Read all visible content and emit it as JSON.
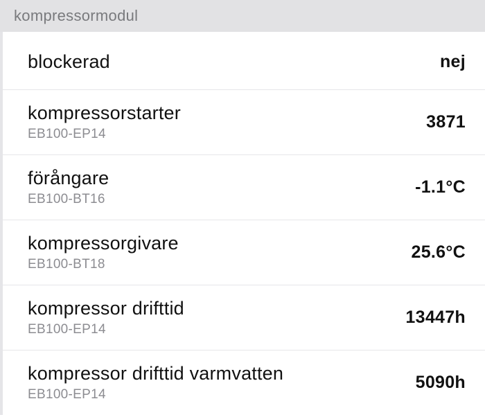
{
  "header": {
    "title": "kompressormodul"
  },
  "rows": [
    {
      "label": "blockerad",
      "sub": "",
      "value": "nej"
    },
    {
      "label": "kompressorstarter",
      "sub": "EB100-EP14",
      "value": "3871"
    },
    {
      "label": "förångare",
      "sub": "EB100-BT16",
      "value": "-1.1°C"
    },
    {
      "label": "kompressorgivare",
      "sub": "EB100-BT18",
      "value": "25.6°C"
    },
    {
      "label": "kompressor drifttid",
      "sub": "EB100-EP14",
      "value": "13447h"
    },
    {
      "label": "kompressor drifttid varmvatten",
      "sub": "EB100-EP14",
      "value": "5090h"
    }
  ]
}
